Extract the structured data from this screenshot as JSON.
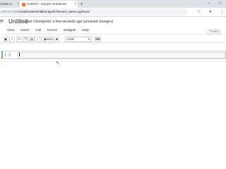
{
  "browser": {
    "tabs": [
      {
        "title": "create a",
        "active": false
      },
      {
        "title": "Untitled - Jupyter Notebook",
        "active": true
      }
    ],
    "new_tab_symbol": "+",
    "window_controls": {
      "minimize": "–",
      "maximize": "□"
    },
    "url_host": "calhost:8888",
    "url_path": "/notebooks/Untitled.ipynb?kernel_name=python3"
  },
  "notebook": {
    "logo_tail": "er",
    "title": "Untitled",
    "checkpoint": "Last Checkpoint: a few seconds ago",
    "save_status": "(unsaved changes)",
    "trusted": "Trusted"
  },
  "menu": [
    "View",
    "Insert",
    "Cell",
    "Kernel",
    "Widgets",
    "Help"
  ],
  "toolbar": {
    "run_label": "Run",
    "cell_type": "Code"
  },
  "cell": {
    "prompt": "[ ]:",
    "content": ""
  },
  "colors": {
    "accent_green": "#66bb6a",
    "jupyter_orange": "#f37726"
  }
}
